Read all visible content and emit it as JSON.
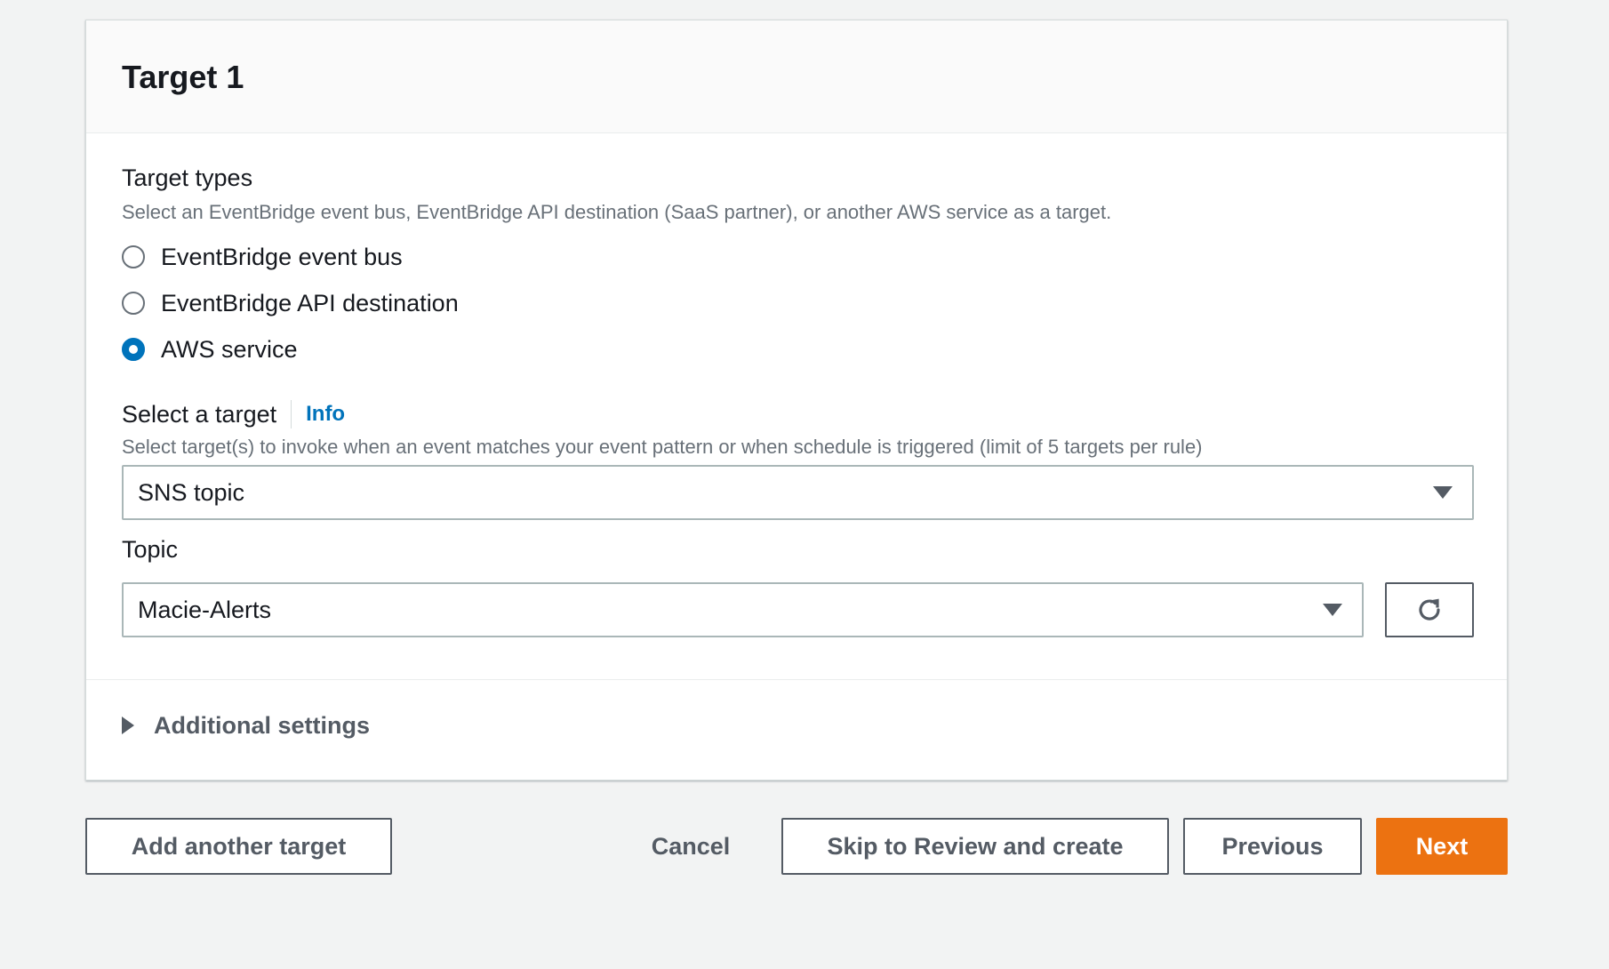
{
  "card": {
    "title": "Target 1"
  },
  "target_types": {
    "label": "Target types",
    "description": "Select an EventBridge event bus, EventBridge API destination (SaaS partner), or another AWS service as a target.",
    "options": [
      {
        "label": "EventBridge event bus",
        "checked": false
      },
      {
        "label": "EventBridge API destination",
        "checked": false
      },
      {
        "label": "AWS service",
        "checked": true
      }
    ]
  },
  "select_target": {
    "label": "Select a target",
    "info": "Info",
    "description": "Select target(s) to invoke when an event matches your event pattern or when schedule is triggered (limit of 5 targets per rule)",
    "value": "SNS topic"
  },
  "topic": {
    "label": "Topic",
    "value": "Macie-Alerts"
  },
  "additional_settings": {
    "label": "Additional settings"
  },
  "footer": {
    "add_target": "Add another target",
    "cancel": "Cancel",
    "skip": "Skip to Review and create",
    "previous": "Previous",
    "next": "Next"
  },
  "colors": {
    "primary": "#ec7211",
    "link": "#0073bb",
    "radio_checked": "#0073bb"
  },
  "icons": {
    "dropdown": "caret-down-icon",
    "refresh": "refresh-icon",
    "expand": "caret-right-icon"
  }
}
